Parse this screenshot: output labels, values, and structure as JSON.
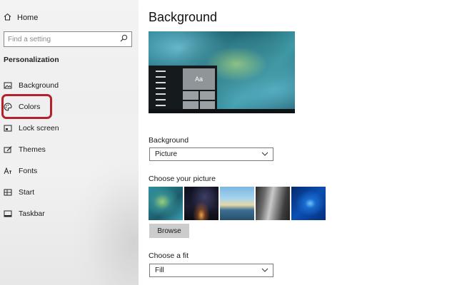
{
  "sidebar": {
    "home_label": "Home",
    "search_placeholder": "Find a setting",
    "section_title": "Personalization",
    "items": [
      {
        "label": "Background",
        "icon": "image-icon"
      },
      {
        "label": "Colors",
        "icon": "palette-icon"
      },
      {
        "label": "Lock screen",
        "icon": "lock-screen-icon"
      },
      {
        "label": "Themes",
        "icon": "brush-icon"
      },
      {
        "label": "Fonts",
        "icon": "font-icon"
      },
      {
        "label": "Start",
        "icon": "start-icon"
      },
      {
        "label": "Taskbar",
        "icon": "taskbar-icon"
      }
    ],
    "highlight_color": "#b3222a"
  },
  "main": {
    "title": "Background",
    "preview": {
      "tile_text": "Aa"
    },
    "background_label": "Background",
    "background_value": "Picture",
    "choose_picture_label": "Choose your picture",
    "pictures": [
      "green-ocean-aerial",
      "night-sky-tent",
      "beach-rocks",
      "rock-waterfall",
      "windows-blue-light"
    ],
    "browse_label": "Browse",
    "fit_label": "Choose a fit",
    "fit_value": "Fill"
  }
}
